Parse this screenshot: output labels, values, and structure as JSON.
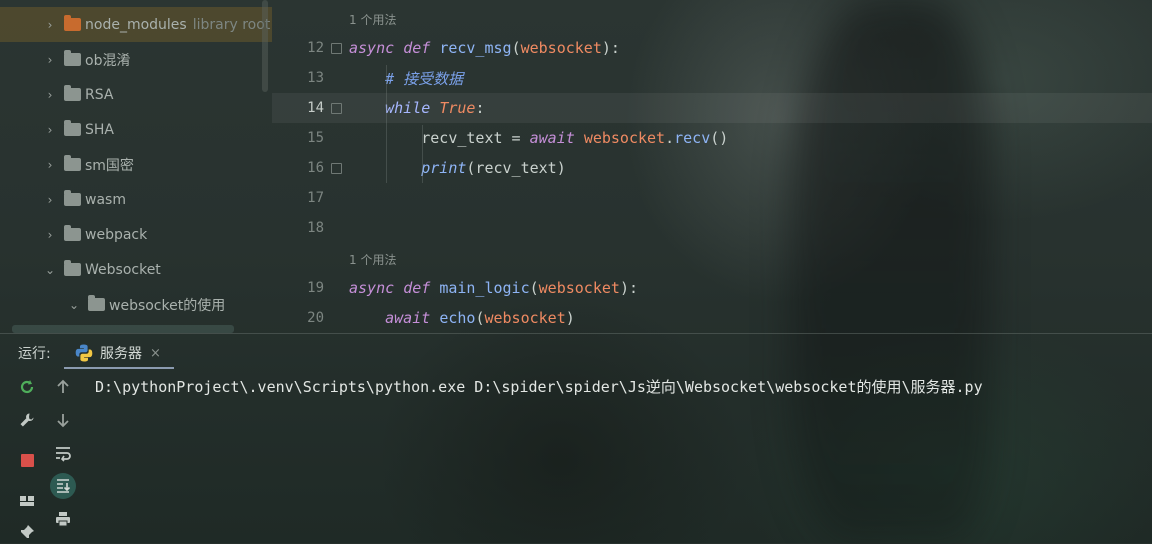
{
  "project_tree": {
    "items": [
      {
        "label": "node_modules",
        "suffix": "library root",
        "expanded": false,
        "selected": true,
        "folder_color": "#c86b2e"
      },
      {
        "label": "ob混淆",
        "expanded": false
      },
      {
        "label": "RSA",
        "expanded": false
      },
      {
        "label": "SHA",
        "expanded": false
      },
      {
        "label": "sm国密",
        "expanded": false
      },
      {
        "label": "wasm",
        "expanded": false
      },
      {
        "label": "webpack",
        "expanded": false
      },
      {
        "label": "Websocket",
        "expanded": true
      },
      {
        "label": "websocket的使用",
        "expanded": true
      }
    ]
  },
  "editor": {
    "usage_hints": [
      "1 个用法",
      "1 个用法"
    ],
    "line_numbers": [
      "12",
      "13",
      "14",
      "15",
      "16",
      "17",
      "18",
      "19",
      "20"
    ],
    "current_line": "14",
    "code": {
      "l12": {
        "async": "async",
        "def": "def",
        "name": "recv_msg",
        "open": "(",
        "param": "websocket",
        "close": "):"
      },
      "l13": {
        "comment": "# 接受数据"
      },
      "l14": {
        "while": "while",
        "value": "True",
        "colon": ":"
      },
      "l15": {
        "var": "recv_text",
        "eq": " = ",
        "await": "await",
        "obj": "websocket",
        "dot": ".",
        "method": "recv",
        "call": "()"
      },
      "l16": {
        "print": "print",
        "args": "(recv_text)"
      },
      "l19": {
        "async": "async",
        "def": "def",
        "name": "main_logic",
        "open": "(",
        "param": "websocket",
        "close": "):"
      },
      "l20": {
        "await": "await",
        "func": "echo",
        "open": "(",
        "arg": "websocket",
        "close": ")"
      }
    }
  },
  "run_panel": {
    "title": "运行:",
    "tab_label": "服务器",
    "tab_close": "×",
    "console_line": "D:\\pythonProject\\.venv\\Scripts\\python.exe D:\\spider\\spider\\Js逆向\\Websocket\\websocket的使用\\服务器.py",
    "toolbar_icons": [
      "rerun-icon",
      "up-arrow-icon",
      "wrench-icon",
      "down-arrow-icon",
      "stop-icon",
      "soft-wrap-icon",
      "layout-icon",
      "scroll-to-end-icon",
      "print-icon",
      "pin-icon"
    ]
  },
  "colors": {
    "keyword": "#c58fd8",
    "function": "#8eb4f5",
    "parameter": "#ef8a62",
    "comment": "#7aa0e8",
    "stop_red": "#d9504a",
    "rerun_green": "#4fae5b"
  }
}
